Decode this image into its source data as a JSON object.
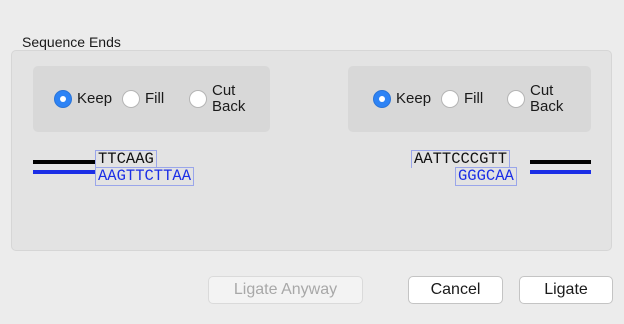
{
  "section_title": "Sequence Ends",
  "left_end": {
    "options": {
      "keep": "Keep",
      "fill": "Fill",
      "cut_back": "Cut\nBack"
    },
    "selected": "Keep",
    "top_strand": "TTCAAG",
    "bottom_strand": "AAGTTCTTAA"
  },
  "right_end": {
    "options": {
      "keep": "Keep",
      "fill": "Fill",
      "cut_back": "Cut\nBack"
    },
    "selected": "Keep",
    "top_strand": "AATTCCCGTT",
    "bottom_strand": "GGGCAA"
  },
  "buttons": {
    "ligate_anyway": "Ligate Anyway",
    "cancel": "Cancel",
    "ligate": "Ligate"
  },
  "colors": {
    "accent": "#2d83f5",
    "strand_blue": "#1b2ee6",
    "strand_outline": "#9aa6ea"
  }
}
